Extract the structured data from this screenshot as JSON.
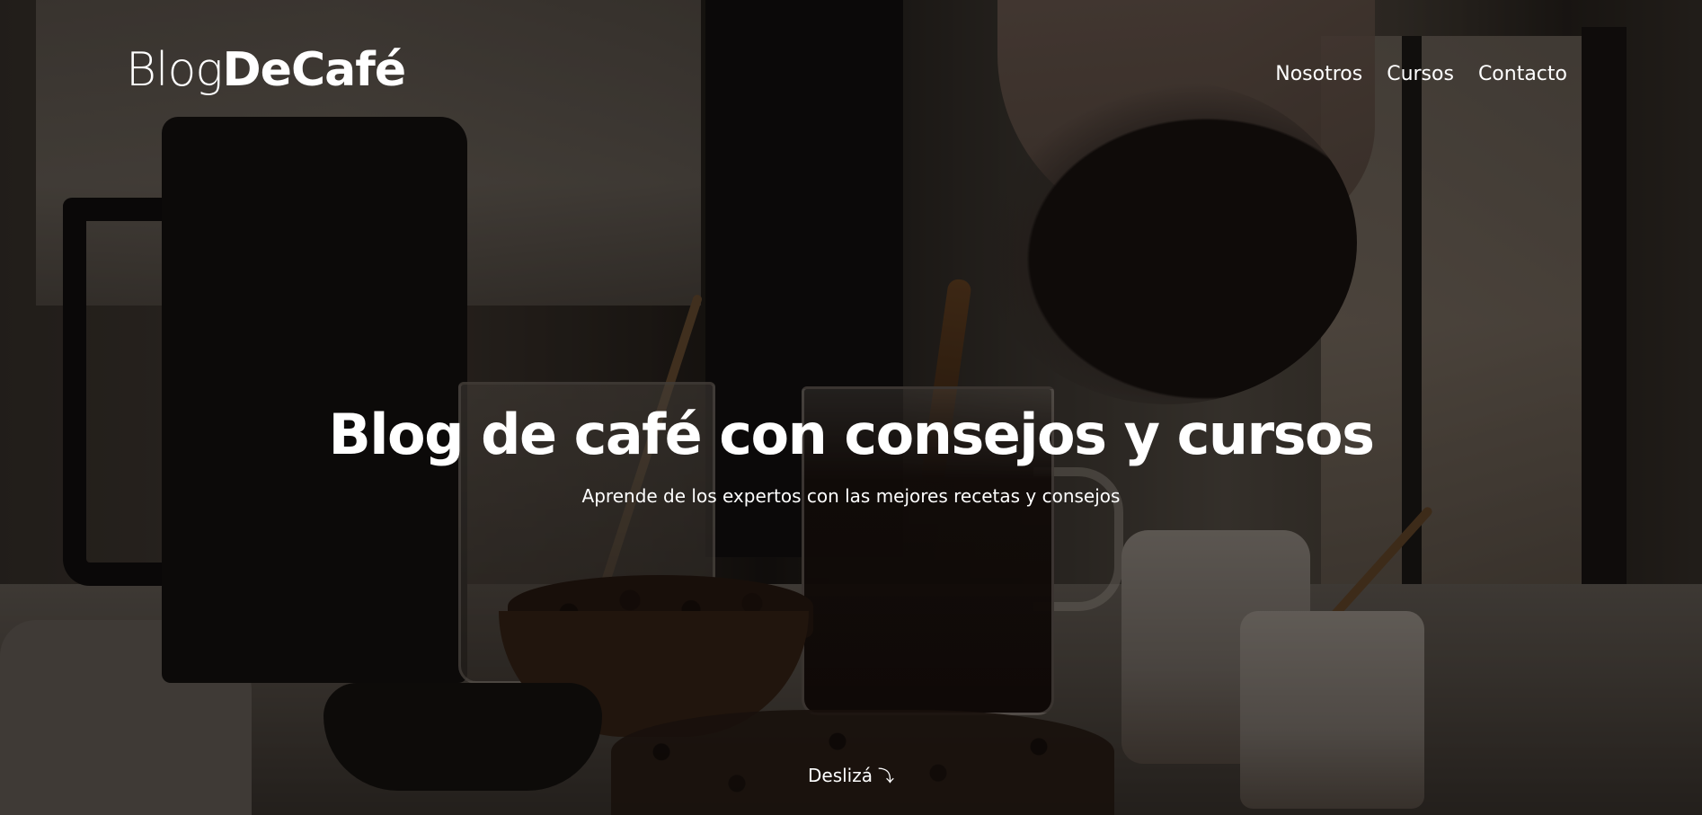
{
  "header": {
    "logo_light": "Blog",
    "logo_bold": "DeCafé",
    "nav": [
      {
        "label": "Nosotros"
      },
      {
        "label": "Cursos"
      },
      {
        "label": "Contacto"
      }
    ]
  },
  "hero": {
    "title": "Blog de café con consejos y cursos",
    "subtitle": "Aprende de los expertos con las mejores recetas y consejos"
  },
  "scroll": {
    "label": "Deslizá",
    "icon": "curved-arrow-down-icon",
    "glyph": "⤵"
  },
  "colors": {
    "text": "#ffffff",
    "overlay": "#000000"
  }
}
